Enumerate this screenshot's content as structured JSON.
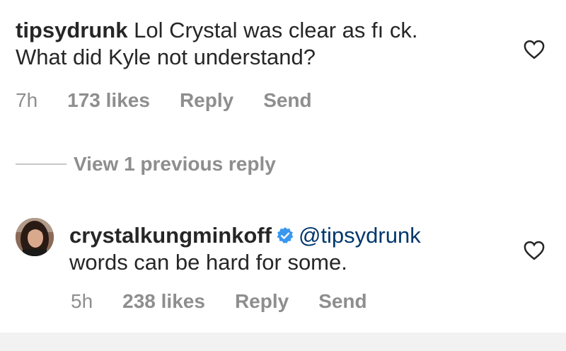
{
  "comment1": {
    "username": "tipsydrunk",
    "text_line1": "Lol Crystal was clear as fı ck.",
    "text_line2": "What did Kyle not understand?",
    "time": "7h",
    "likes": "173 likes",
    "reply": "Reply",
    "send": "Send"
  },
  "view_replies": {
    "label": "View 1 previous reply"
  },
  "reply1": {
    "username": "crystalkungminkoff",
    "mention": "@tipsydrunk",
    "text": "words can be hard for some.",
    "time": "5h",
    "likes": "238 likes",
    "reply": "Reply",
    "send": "Send"
  },
  "icons": {
    "like": "heart-icon",
    "verified": "verified-badge-icon"
  },
  "colors": {
    "text": "#262626",
    "meta": "#8e8e8e",
    "mention": "#00376b",
    "verified": "#3897f0"
  }
}
